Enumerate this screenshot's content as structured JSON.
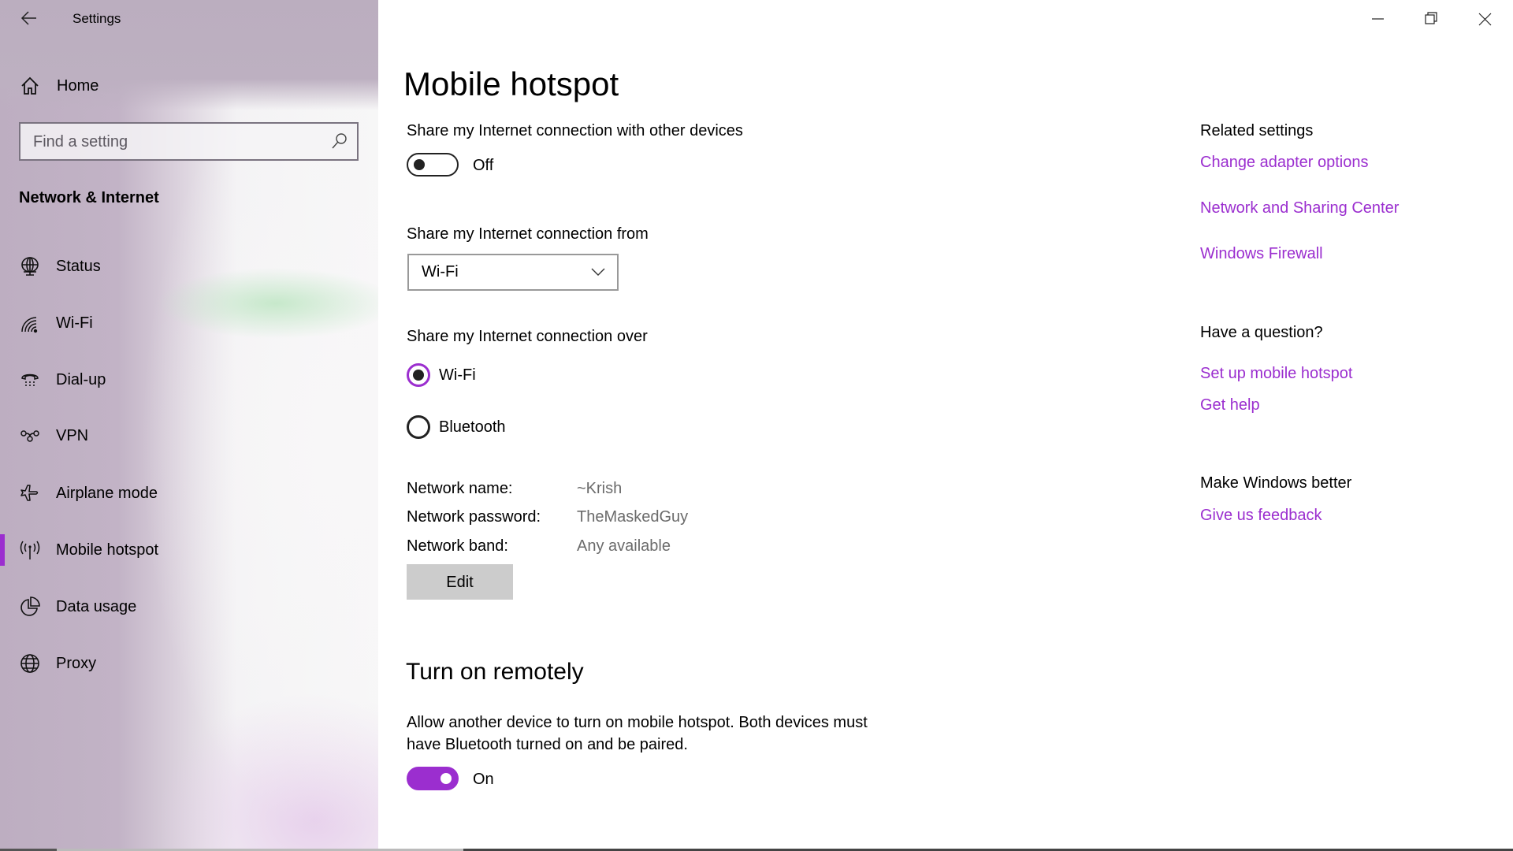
{
  "window": {
    "title": "Settings",
    "controls": [
      "minimize-icon",
      "restore-icon",
      "close-icon"
    ]
  },
  "sidebar": {
    "home_label": "Home",
    "search_placeholder": "Find a setting",
    "section_title": "Network & Internet",
    "items": [
      {
        "label": "Status",
        "icon": "status-globe-icon"
      },
      {
        "label": "Wi-Fi",
        "icon": "wifi-icon"
      },
      {
        "label": "Dial-up",
        "icon": "dialup-phone-icon"
      },
      {
        "label": "VPN",
        "icon": "vpn-icon"
      },
      {
        "label": "Airplane mode",
        "icon": "airplane-icon"
      },
      {
        "label": "Mobile hotspot",
        "icon": "hotspot-antenna-icon",
        "selected": true
      },
      {
        "label": "Data usage",
        "icon": "pie-chart-icon"
      },
      {
        "label": "Proxy",
        "icon": "globe-icon"
      }
    ]
  },
  "main": {
    "title": "Mobile hotspot",
    "share_label": "Share my Internet connection with other devices",
    "share_toggle": {
      "state": false,
      "label": "Off"
    },
    "from_label": "Share my Internet connection from",
    "from_value": "Wi-Fi",
    "over_label": "Share my Internet connection over",
    "over_options": [
      {
        "label": "Wi-Fi",
        "checked": true
      },
      {
        "label": "Bluetooth",
        "checked": false
      }
    ],
    "network_info": [
      {
        "key": "Network name:",
        "value": "~Krish"
      },
      {
        "key": "Network password:",
        "value": "TheMaskedGuy"
      },
      {
        "key": "Network band:",
        "value": "Any available"
      }
    ],
    "edit_label": "Edit",
    "remote_title": "Turn on remotely",
    "remote_desc_line1": "Allow another device to turn on mobile hotspot. Both devices must",
    "remote_desc_line2": "have Bluetooth turned on and be paired.",
    "remote_toggle": {
      "state": true,
      "label": "On"
    }
  },
  "related": {
    "title": "Related settings",
    "links": [
      "Change adapter options",
      "Network and Sharing Center",
      "Windows Firewall"
    ],
    "question_title": "Have a question?",
    "question_links": [
      "Set up mobile hotspot",
      "Get help"
    ],
    "better_title": "Make Windows better",
    "better_links": [
      "Give us feedback"
    ]
  },
  "colors": {
    "accent": "#9b2ecf",
    "sidebar": "#bdaec1"
  }
}
